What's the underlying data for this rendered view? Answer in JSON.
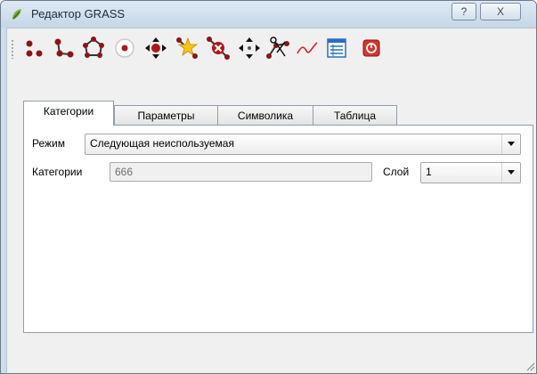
{
  "window": {
    "title": "Редактор GRASS",
    "help_label": "?",
    "close_label": "X"
  },
  "toolbar": {
    "tools": [
      {
        "icon": "new-point-icon"
      },
      {
        "icon": "new-line-icon"
      },
      {
        "icon": "new-boundary-icon"
      },
      {
        "icon": "new-centroid-icon"
      },
      {
        "icon": "move-vertex-icon"
      },
      {
        "icon": "add-vertex-icon"
      },
      {
        "icon": "delete-vertex-icon"
      },
      {
        "icon": "move-element-icon"
      },
      {
        "icon": "split-line-icon"
      },
      {
        "icon": "edit-line-icon"
      },
      {
        "icon": "attribute-table-icon"
      },
      {
        "icon": "close-editor-icon"
      }
    ]
  },
  "tabs": [
    {
      "label": "Категории",
      "active": true
    },
    {
      "label": "Параметры",
      "active": false
    },
    {
      "label": "Символика",
      "active": false
    },
    {
      "label": "Таблица",
      "active": false
    }
  ],
  "categories": {
    "mode_label": "Режим",
    "mode_value": "Следующая неиспользуемая",
    "category_label": "Категории",
    "category_value": "666",
    "layer_label": "Слой",
    "layer_value": "1"
  },
  "colors": {
    "accent_red": "#b0161a",
    "title_bar": "#c6d6e8"
  }
}
